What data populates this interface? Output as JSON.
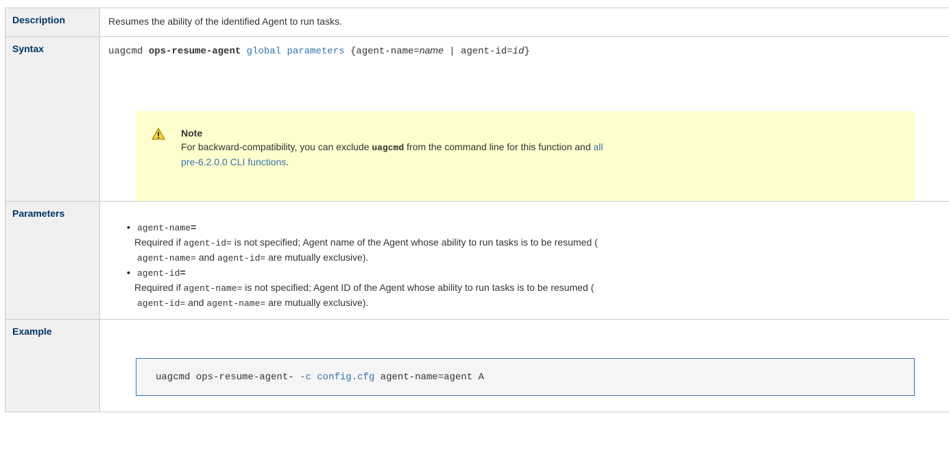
{
  "rows": {
    "description": {
      "label": "Description",
      "text": "Resumes the ability of the identified Agent to run tasks."
    },
    "syntax": {
      "label": "Syntax",
      "cmd": "uagcmd",
      "keyword": "ops-resume-agent",
      "global_params": "global parameters",
      "brace_open": "{agent-name=",
      "name_placeholder": "name",
      "separator": " | agent-id=",
      "id_placeholder": "id",
      "brace_close": "}",
      "note": {
        "title": "Note",
        "text_before": "For backward-compatibility, you can exclude ",
        "code": "uagcmd",
        "text_middle": " from the command line for this function and ",
        "link_line1": "all",
        "link_line2": "pre-6.2.0.0 CLI functions",
        "text_after": "."
      }
    },
    "parameters": {
      "label": "Parameters",
      "items": [
        {
          "name": "agent-name",
          "eq": "=",
          "desc_before": "Required if ",
          "desc_code1": "agent-id=",
          "desc_mid": " is not specified; Agent name of the Agent whose ability to run tasks is to be resumed (",
          "desc_code2": "agent-name=",
          "desc_and": " and ",
          "desc_code3": "agent-id=",
          "desc_end": " are mutually exclusive)."
        },
        {
          "name": "agent-id",
          "eq": "=",
          "desc_before": "Required if ",
          "desc_code1": "agent-name=",
          "desc_mid": " is not specified; Agent ID of the Agent whose ability to run tasks is to be resumed (",
          "desc_code2": "agent-id=",
          "desc_and": " and ",
          "desc_code3": "agent-name=",
          "desc_end": " are mutually exclusive)."
        }
      ]
    },
    "example": {
      "label": "Example",
      "code_before": "uagcmd ops-resume-agent- ",
      "code_option": "-c config.cfg",
      "code_after": " agent-name=agent A"
    }
  },
  "colors": {
    "header_bg": "#f0f0f0",
    "header_text": "#003366",
    "link": "#3572b0",
    "note_bg": "#ffffce",
    "code_bg": "#f5f5f5"
  }
}
